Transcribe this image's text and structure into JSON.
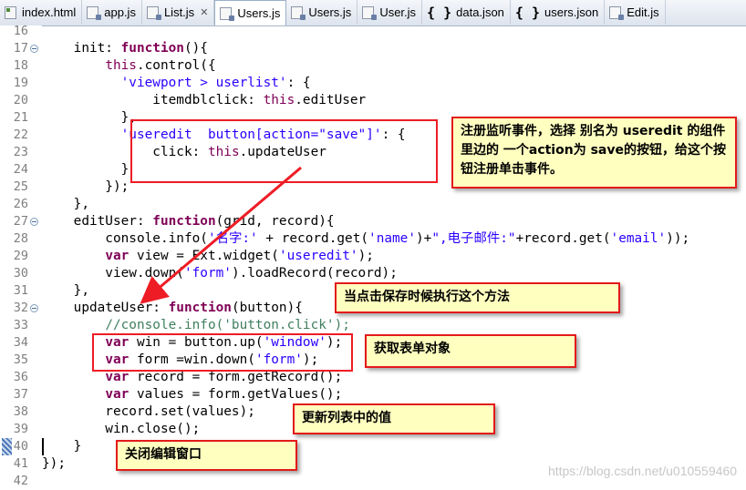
{
  "tabs": [
    {
      "label": "index.html",
      "icon": "html-file-icon",
      "active": false,
      "close": false
    },
    {
      "label": "app.js",
      "icon": "js-file-icon",
      "active": false,
      "close": false
    },
    {
      "label": "List.js",
      "icon": "js-file-icon",
      "active": false,
      "close": true
    },
    {
      "label": "Users.js",
      "icon": "js-file-icon",
      "active": true,
      "close": false
    },
    {
      "label": "Users.js",
      "icon": "js-file-icon",
      "active": false,
      "close": false
    },
    {
      "label": "User.js",
      "icon": "js-file-icon",
      "active": false,
      "close": false
    },
    {
      "label": "data.json",
      "icon": "json-file-icon",
      "active": false,
      "close": false
    },
    {
      "label": "users.json",
      "icon": "json-file-icon",
      "active": false,
      "close": false
    },
    {
      "label": "Edit.js",
      "icon": "js-file-icon",
      "active": false,
      "close": false
    }
  ],
  "close_glyph": "✕",
  "lines": [
    {
      "num": "16",
      "fold": false,
      "tokens": []
    },
    {
      "num": "17",
      "fold": true,
      "tokens": [
        [
          "",
          "    init: "
        ],
        [
          "k",
          "function"
        ],
        [
          "",
          "(){"
        ]
      ]
    },
    {
      "num": "18",
      "fold": false,
      "tokens": [
        [
          "",
          "        "
        ],
        [
          "th",
          "this"
        ],
        [
          "",
          ".control({"
        ]
      ]
    },
    {
      "num": "19",
      "fold": false,
      "tokens": [
        [
          "",
          "          "
        ],
        [
          "s",
          "'viewport > userlist'"
        ],
        [
          "",
          ": {"
        ]
      ]
    },
    {
      "num": "20",
      "fold": false,
      "tokens": [
        [
          "",
          "              itemdblclick: "
        ],
        [
          "th",
          "this"
        ],
        [
          "",
          ".editUser"
        ]
      ]
    },
    {
      "num": "21",
      "fold": false,
      "tokens": [
        [
          "",
          "          },"
        ]
      ]
    },
    {
      "num": "22",
      "fold": false,
      "tokens": [
        [
          "",
          "          "
        ],
        [
          "s",
          "'useredit  button[action=\"save\"]'"
        ],
        [
          "",
          ": {"
        ]
      ]
    },
    {
      "num": "23",
      "fold": false,
      "tokens": [
        [
          "",
          "              click: "
        ],
        [
          "th",
          "this"
        ],
        [
          "",
          ".updateUser"
        ]
      ]
    },
    {
      "num": "24",
      "fold": false,
      "tokens": [
        [
          "",
          "          }"
        ]
      ]
    },
    {
      "num": "25",
      "fold": false,
      "tokens": [
        [
          "",
          "        });"
        ]
      ]
    },
    {
      "num": "26",
      "fold": false,
      "tokens": [
        [
          "",
          "    },"
        ]
      ]
    },
    {
      "num": "27",
      "fold": true,
      "tokens": [
        [
          "",
          "    editUser: "
        ],
        [
          "k",
          "function"
        ],
        [
          "",
          "(grid, record){"
        ]
      ]
    },
    {
      "num": "28",
      "fold": false,
      "tokens": [
        [
          "",
          "        console.info("
        ],
        [
          "s",
          "'名字:'"
        ],
        [
          "",
          " + record.get("
        ],
        [
          "s",
          "'name'"
        ],
        [
          "",
          ")+"
        ],
        [
          "s",
          "\",电子邮件:\""
        ],
        [
          "",
          "+record.get("
        ],
        [
          "s",
          "'email'"
        ],
        [
          "",
          "));"
        ]
      ]
    },
    {
      "num": "29",
      "fold": false,
      "tokens": [
        [
          "",
          "        "
        ],
        [
          "k",
          "var"
        ],
        [
          "",
          " view = Ext.widget("
        ],
        [
          "s",
          "'useredit'"
        ],
        [
          "",
          ");"
        ]
      ]
    },
    {
      "num": "30",
      "fold": false,
      "tokens": [
        [
          "",
          "        view.down("
        ],
        [
          "s",
          "'form'"
        ],
        [
          "",
          ").loadRecord(record);"
        ]
      ]
    },
    {
      "num": "31",
      "fold": false,
      "tokens": [
        [
          "",
          "    },"
        ]
      ]
    },
    {
      "num": "32",
      "fold": true,
      "tokens": [
        [
          "",
          "    updateUser: "
        ],
        [
          "k",
          "function"
        ],
        [
          "",
          "(button){"
        ]
      ]
    },
    {
      "num": "33",
      "fold": false,
      "tokens": [
        [
          "",
          "        "
        ],
        [
          "cm",
          "//console.info('button.click');"
        ]
      ]
    },
    {
      "num": "34",
      "fold": false,
      "tokens": [
        [
          "",
          "        "
        ],
        [
          "k",
          "var"
        ],
        [
          "",
          " win = button.up("
        ],
        [
          "s",
          "'window'"
        ],
        [
          "",
          ");"
        ]
      ]
    },
    {
      "num": "35",
      "fold": false,
      "tokens": [
        [
          "",
          "        "
        ],
        [
          "k",
          "var"
        ],
        [
          "",
          " form =win.down("
        ],
        [
          "s",
          "'form'"
        ],
        [
          "",
          ");"
        ]
      ]
    },
    {
      "num": "36",
      "fold": false,
      "tokens": [
        [
          "",
          "        "
        ],
        [
          "k",
          "var"
        ],
        [
          "",
          " record = form.getRecord();"
        ]
      ]
    },
    {
      "num": "37",
      "fold": false,
      "tokens": [
        [
          "",
          "        "
        ],
        [
          "k",
          "var"
        ],
        [
          "",
          " values = form.getValues();"
        ]
      ]
    },
    {
      "num": "38",
      "fold": false,
      "tokens": [
        [
          "",
          "        record.set(values);"
        ]
      ]
    },
    {
      "num": "39",
      "fold": false,
      "tokens": [
        [
          "",
          "        win.close();"
        ]
      ]
    },
    {
      "num": "40",
      "fold": false,
      "tokens": [
        [
          "",
          "    }"
        ]
      ]
    },
    {
      "num": "41",
      "fold": false,
      "tokens": [
        [
          "",
          "});"
        ]
      ]
    },
    {
      "num": "42",
      "fold": false,
      "tokens": []
    }
  ],
  "notes": {
    "listener": "注册监听事件，选择 别名为 useredit 的组件里边的 一个action为 save的按钮，给这个按钮注册单击事件。",
    "save": "当点击保存时候执行这个方法",
    "getform": "获取表单对象",
    "update": "更新列表中的值",
    "close": "关闭编辑窗口"
  },
  "watermark": "https://blog.csdn.net/u010559460"
}
